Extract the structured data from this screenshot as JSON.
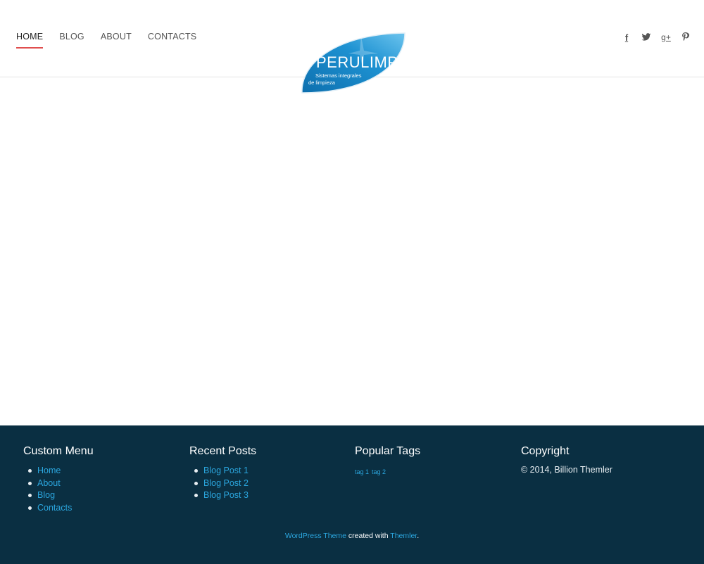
{
  "nav": {
    "items": [
      {
        "label": "HOME",
        "active": true
      },
      {
        "label": "BLOG",
        "active": false
      },
      {
        "label": "ABOUT",
        "active": false
      },
      {
        "label": "CONTACTS",
        "active": false
      }
    ]
  },
  "logo": {
    "title": "PERULIMP",
    "tagline_1": "Sistemas integrales",
    "tagline_2": "de limpieza"
  },
  "social": {
    "icons": [
      "facebook-icon",
      "twitter-icon",
      "google-plus-icon",
      "pinterest-icon"
    ],
    "facebook": "f",
    "google": "g+"
  },
  "footer": {
    "custom_menu": {
      "title": "Custom Menu",
      "items": [
        "Home",
        "About",
        "Blog",
        "Contacts"
      ]
    },
    "recent_posts": {
      "title": "Recent Posts",
      "items": [
        "Blog Post 1",
        "Blog Post 2",
        "Blog Post 3"
      ]
    },
    "popular_tags": {
      "title": "Popular Tags",
      "tags": [
        "tag 1",
        "tag 2"
      ]
    },
    "copyright": {
      "title": "Copyright",
      "text": "© 2014, Billion Themler"
    },
    "credit": {
      "link1": "WordPress Theme",
      "middle": "created with",
      "link2": "Themler",
      "end": "."
    }
  },
  "colors": {
    "accent": "#e04e4e",
    "footer_bg": "#0a2f42",
    "link": "#2ba6de",
    "logo_blue": "#1e88c8"
  }
}
